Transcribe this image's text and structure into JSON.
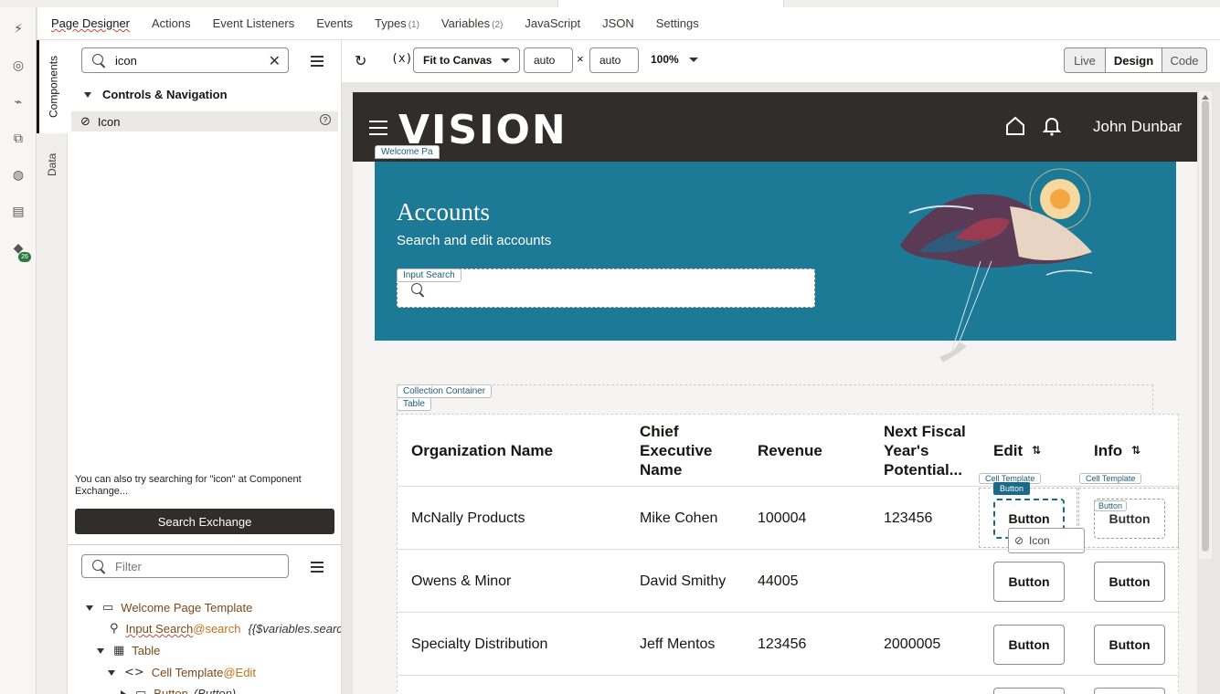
{
  "menu": {
    "tabs": [
      {
        "label": "Page Designer",
        "count": ""
      },
      {
        "label": "Actions",
        "count": ""
      },
      {
        "label": "Event Listeners",
        "count": ""
      },
      {
        "label": "Events",
        "count": ""
      },
      {
        "label": "Types",
        "count": "(1)"
      },
      {
        "label": "Variables",
        "count": "(2)"
      },
      {
        "label": "JavaScript",
        "count": ""
      },
      {
        "label": "JSON",
        "count": ""
      },
      {
        "label": "Settings",
        "count": ""
      }
    ]
  },
  "side_tabs": {
    "components": "Components",
    "data": "Data"
  },
  "rail": {
    "badge": "26"
  },
  "components": {
    "search_value": "icon",
    "group": "Controls & Navigation",
    "item": "Icon",
    "hint": "You can also try searching for \"icon\" at Component Exchange...",
    "exchange_button": "Search Exchange"
  },
  "tree": {
    "filter_placeholder": "Filter",
    "items": [
      {
        "label": "Welcome Page Template",
        "suffix": "",
        "extra": ""
      },
      {
        "label": "Input Search",
        "suffix": "@search",
        "extra": "{{$variables.searchS"
      },
      {
        "label": "Table",
        "suffix": "",
        "extra": ""
      },
      {
        "label": "Cell Template",
        "suffix": "@Edit",
        "extra": ""
      },
      {
        "label": "Button",
        "suffix": "",
        "extra": "(Button)"
      }
    ]
  },
  "toolbar": {
    "fit": "Fit to Canvas",
    "width": "auto",
    "times": "×",
    "height": "auto",
    "zoom": "100%",
    "modes": [
      "Live",
      "Design",
      "Code"
    ],
    "active_mode": "Design"
  },
  "app": {
    "brand": "VISION",
    "user": "John Dunbar",
    "welcome_label": "Welcome Pa",
    "title": "Accounts",
    "subtitle": "Search and edit accounts",
    "input_search_label": "Input Search",
    "collection_label": "Collection Container",
    "table_label": "Table",
    "cell_template_label": "Cell Template",
    "button_label": "Button",
    "drag_icon_label": "Icon"
  },
  "table": {
    "headers": [
      "Organization Name",
      "Chief Executive Name",
      "Revenue",
      "Next Fiscal Year's Potential...",
      "Edit",
      "Info"
    ],
    "rows": [
      {
        "org": "McNally Products",
        "ceo": "Mike Cohen",
        "revenue": "100004",
        "next": "123456",
        "edit": "Button",
        "info": "Button"
      },
      {
        "org": "Owens & Minor",
        "ceo": "David Smithy",
        "revenue": "44005",
        "next": "",
        "edit": "Button",
        "info": "Button"
      },
      {
        "org": "Specialty Distribution",
        "ceo": "Jeff Mentos",
        "revenue": "123456",
        "next": "2000005",
        "edit": "Button",
        "info": "Button"
      }
    ]
  }
}
